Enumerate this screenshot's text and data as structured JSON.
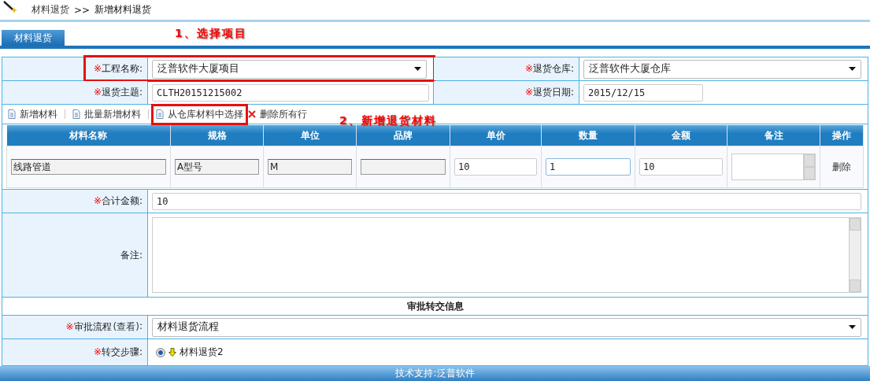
{
  "breadcrumb": {
    "items": [
      "材料退货",
      "新增材料退货"
    ],
    "separator": ">>"
  },
  "tabs": [
    {
      "label": "材料退货",
      "selected": true
    }
  ],
  "annotations": [
    {
      "text": "1、选择项目"
    },
    {
      "text": "2、新增退货材料"
    }
  ],
  "form_rows": [
    [
      {
        "mark": "※",
        "label": "工程名称:",
        "kind": "select",
        "value": "泛普软件大厦项目",
        "highlight": true
      },
      {
        "mark": "※",
        "label": "退货仓库:",
        "kind": "select",
        "value": "泛普软件大厦仓库",
        "highlight": false
      }
    ],
    [
      {
        "mark": "※",
        "label": "退货主题:",
        "kind": "text",
        "value": "CLTH20151215002",
        "highlight": false
      },
      {
        "mark": "※",
        "label": "退货日期:",
        "kind": "date",
        "value": "2015/12/15",
        "highlight": false
      }
    ]
  ],
  "toolbar": [
    {
      "label": "新增材料",
      "kind": "add",
      "highlight": false
    },
    {
      "label": "批量新增材料",
      "kind": "add",
      "highlight": false
    },
    {
      "label": "从仓库材料中选择",
      "kind": "add",
      "highlight": true
    },
    {
      "label": "删除所有行",
      "kind": "delete",
      "highlight": false
    }
  ],
  "grid": {
    "columns": [
      {
        "label": "材料名称",
        "kind": "readonly"
      },
      {
        "label": "规格",
        "kind": "readonly"
      },
      {
        "label": "单位",
        "kind": "readonly"
      },
      {
        "label": "品牌",
        "kind": "readonly"
      },
      {
        "label": "单价",
        "kind": "input"
      },
      {
        "label": "数量",
        "kind": "input"
      },
      {
        "label": "金额",
        "kind": "input"
      },
      {
        "label": "备注",
        "kind": "textarea"
      },
      {
        "label": "操作",
        "kind": "action"
      }
    ],
    "rows": [
      [
        "线路管道",
        "A型号",
        "M",
        "",
        "10",
        "1",
        "10",
        "",
        "删除"
      ]
    ]
  },
  "total": {
    "mark": "※",
    "label": "合计金额:",
    "value": "10"
  },
  "remarks": {
    "label": "备注:"
  },
  "section_title": "审批转交信息",
  "approval": {
    "mark": "※",
    "label": "审批流程",
    "link": "(查看)",
    "colon": ":",
    "value": "材料退货流程"
  },
  "steps": {
    "mark": "※",
    "label": "转交步骤:",
    "options": [
      {
        "label": "材料退货2",
        "selected": true
      }
    ]
  },
  "footer": "技术支持:泛普软件"
}
